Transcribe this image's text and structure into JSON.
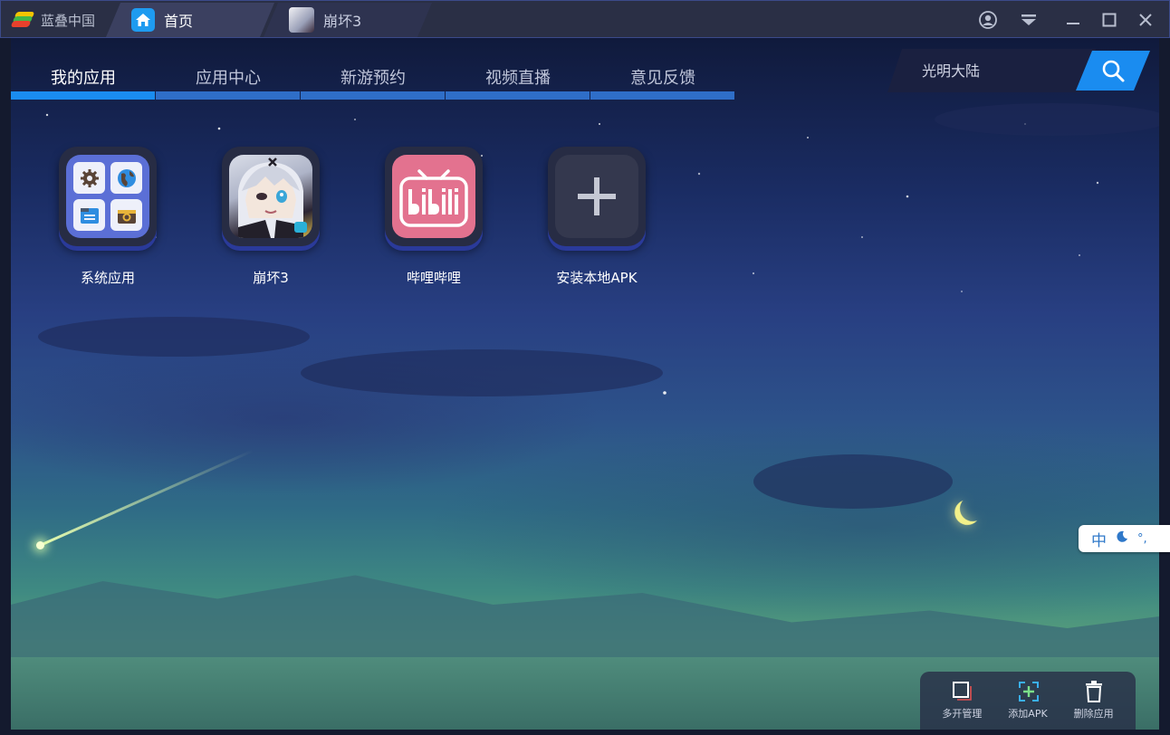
{
  "app": {
    "brand_name": "蓝叠中国"
  },
  "tabs": [
    {
      "label": "首页",
      "active": true
    },
    {
      "label": "崩坏3",
      "active": false
    }
  ],
  "window_controls": [
    "account-icon",
    "menu-dropdown-icon",
    "minimize-icon",
    "maximize-icon",
    "close-icon"
  ],
  "nav": {
    "items": [
      {
        "label": "我的应用",
        "active": true
      },
      {
        "label": "应用中心",
        "active": false
      },
      {
        "label": "新游预约",
        "active": false
      },
      {
        "label": "视频直播",
        "active": false
      },
      {
        "label": "意见反馈",
        "active": false
      }
    ]
  },
  "search": {
    "placeholder": "光明大陆"
  },
  "apps": [
    {
      "label": "系统应用",
      "icon": "system-apps-icon"
    },
    {
      "label": "崩坏3",
      "icon": "honkai-impact-icon"
    },
    {
      "label": "哔哩哔哩",
      "icon": "bilibili-icon"
    },
    {
      "label": "安装本地APK",
      "icon": "plus-icon"
    }
  ],
  "ime": {
    "mode_label": "中",
    "punct_label": "°,"
  },
  "toolbar": {
    "items": [
      {
        "label": "多开管理",
        "icon": "multi-instance-icon"
      },
      {
        "label": "添加APK",
        "icon": "add-apk-icon"
      },
      {
        "label": "删除应用",
        "icon": "delete-app-icon"
      }
    ]
  },
  "colors": {
    "accent": "#1a8cf0",
    "titlebar": "#2a2f45",
    "bilibili_pink": "#e3728f"
  }
}
